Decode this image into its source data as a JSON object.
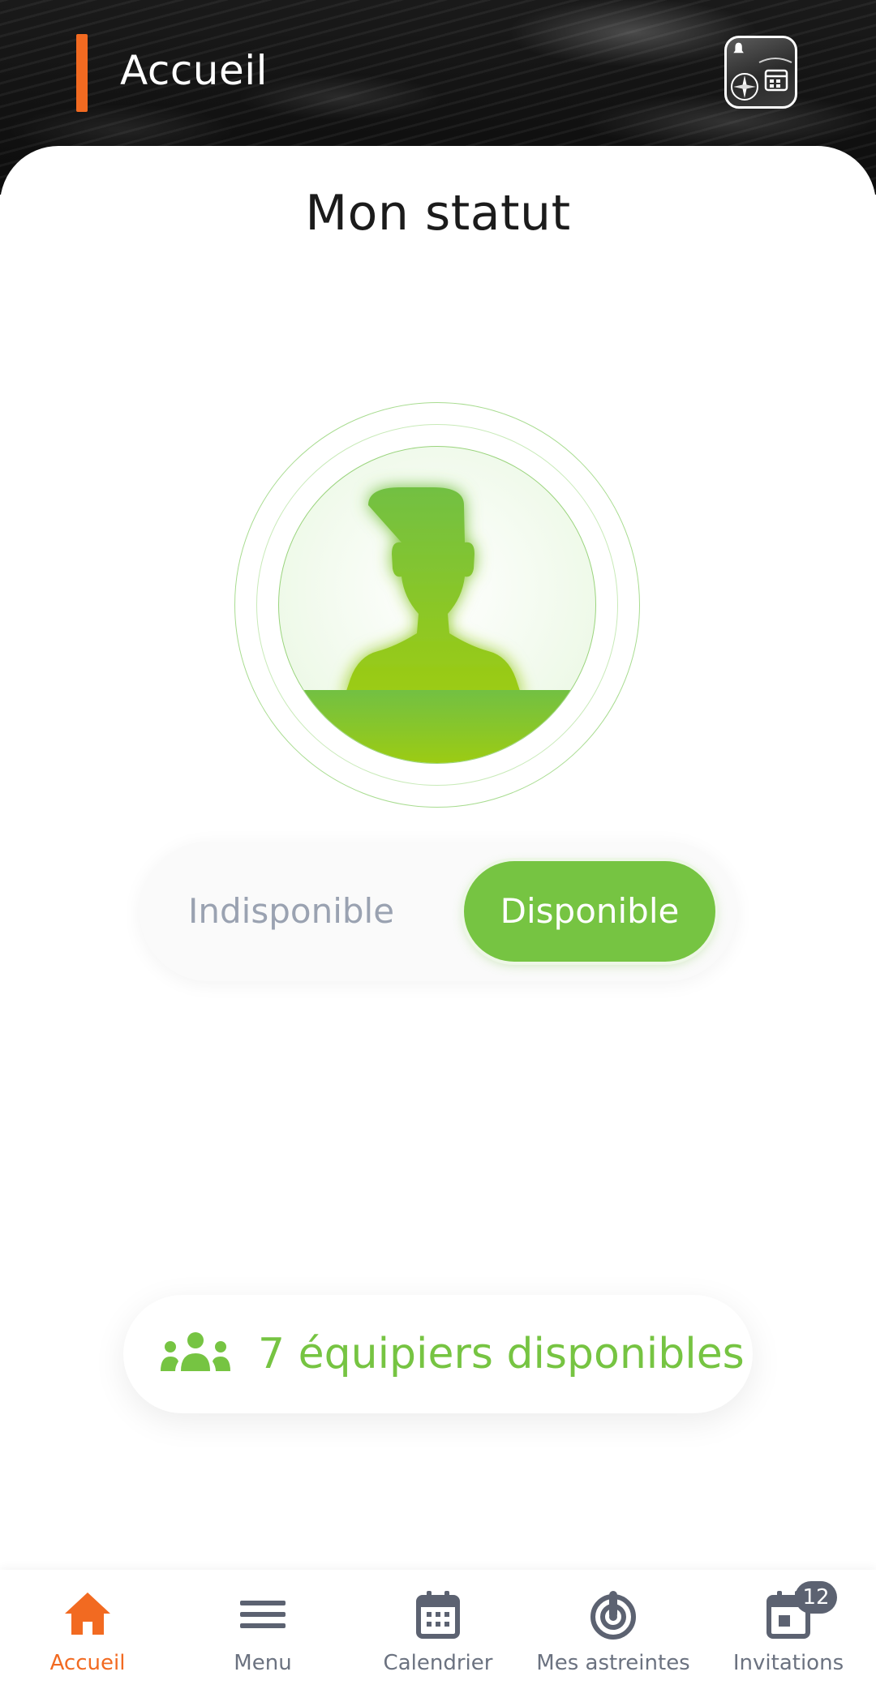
{
  "header": {
    "title": "Accueil",
    "app_icon": "notification-calendar-app-icon"
  },
  "main": {
    "title": "Mon statut",
    "avatar_icon": "person-silhouette-icon",
    "status_toggle": {
      "off_label": "Indisponible",
      "on_label": "Disponible",
      "selected": "Disponible"
    },
    "team": {
      "icon": "group-icon",
      "label": "7 équipiers disponibles"
    }
  },
  "bottom_nav": {
    "items": [
      {
        "label": "Accueil",
        "icon": "home-icon",
        "active": true
      },
      {
        "label": "Menu",
        "icon": "menu-icon",
        "active": false
      },
      {
        "label": "Calendrier",
        "icon": "calendar-icon",
        "active": false
      },
      {
        "label": "Mes astreintes",
        "icon": "target-icon",
        "active": false
      },
      {
        "label": "Invitations",
        "icon": "calendar-invite-icon",
        "active": false,
        "badge": "12"
      }
    ]
  },
  "colors": {
    "accent": "#f26a21",
    "available_green": "#76c442",
    "inactive_text": "#9aa2b1",
    "nav_icon": "#5c6271"
  }
}
